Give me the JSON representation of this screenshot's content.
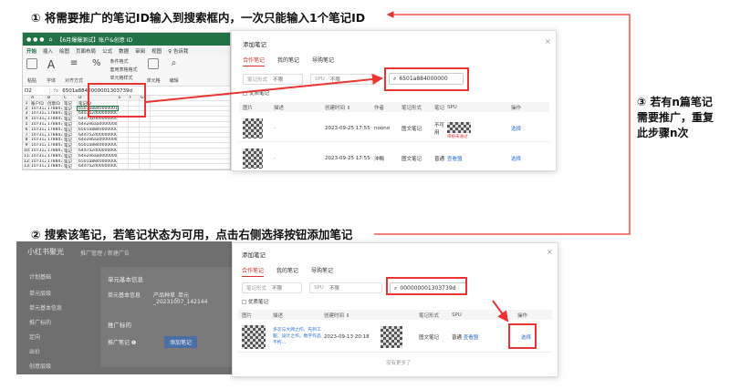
{
  "steps": {
    "step1": "① 将需要推广的笔记ID输入到搜索框内，一次只能输入1个笔记ID",
    "step2": "② 搜索该笔记，若笔记状态为可用，点击右侧选择按钮添加笔记",
    "step3_lines": [
      "③ 若有n篇笔记",
      "需要推广，重复",
      "此步骤n次"
    ]
  },
  "excel": {
    "title": "【6月爆爆测试】账户&创意 ID",
    "menu": [
      "开始",
      "插入",
      "绘图",
      "页面布局",
      "公式",
      "数据",
      "审阅",
      "视图",
      "♀ 告诉我"
    ],
    "ribbon": [
      "粘贴",
      "字体",
      "对齐方式",
      "%",
      "条件格式",
      "套用表格格式",
      "单元格样式",
      "单元格",
      "编辑"
    ],
    "name_box": "D2",
    "formula": "6501a8840000001303739d",
    "headers": [
      "",
      "A",
      "B",
      "C",
      "D",
      "E",
      "F",
      "G"
    ],
    "row_labels": [
      "1",
      "2",
      "3",
      "4",
      "5",
      "6",
      "7",
      "8",
      "9",
      "10",
      "11",
      "12",
      "13"
    ],
    "col_a": [
      "账户ID",
      "107312",
      "107312",
      "107312",
      "107312",
      "107312",
      "107312",
      "107312",
      "107312",
      "107312",
      "107312",
      "107312",
      "107312"
    ],
    "col_b": [
      "创意ID",
      "17884700",
      "17884701",
      "17884702",
      "17884703",
      "17884704",
      "17884705",
      "17884706",
      "17884707",
      "17884708",
      "17884709",
      "17884710",
      "17884711"
    ],
    "col_c": [
      "笔记",
      "笔记",
      "笔记",
      "笔记",
      "笔记",
      "笔记",
      "笔记",
      "笔记",
      "笔记",
      "笔记",
      "笔记",
      "笔记",
      "笔记"
    ],
    "col_d": [
      "笔记ID",
      "6501a8840000001303739d",
      "64d752d0000000001303a",
      "64d752d00000000010031d54",
      "64e2ebaa00000000013045",
      "6501a8840000000013d04",
      "64d752d000000000031d54",
      "64e2ebaa0000000000135",
      "6501a884000000001303",
      "64d752d00000000100031d54",
      "64e2ebaa000000000130a1",
      "6501a88400000000130374",
      "64d752d000000000001303a"
    ]
  },
  "dialog1": {
    "title": "添加笔记",
    "tabs": [
      "合作笔记",
      "我的笔记",
      "导购笔记"
    ],
    "filter1_label": "笔记形式",
    "filter1_value": "不限",
    "filter2_label": "SPU",
    "filter2_value": "不限",
    "search_value": "6501a884000000",
    "checkbox": "优质笔记",
    "columns": [
      "图片",
      "描述",
      "创建时间 ⇕",
      "作者",
      "笔记形式",
      "笔记",
      "SPU",
      "操作"
    ],
    "rows": [
      {
        "date": "2023-09-25 17:55",
        "author": "noono",
        "type": "图文笔记",
        "status": "不可用",
        "spu": "",
        "note": "审核未通过",
        "action": "选择"
      },
      {
        "date": "2023-09-25 17:55",
        "author": "沖鴨",
        "type": "图文笔记",
        "status": "普通",
        "spu": "查看盟",
        "note": "",
        "action": "选择"
      }
    ]
  },
  "app2": {
    "logo": "小红书聚光",
    "breadcrumb": "推广管理 / 新建广告",
    "nav": [
      "计划基础",
      "单元层级",
      "单元基本信息",
      "推广标的",
      "定向",
      "出价",
      "创意层级"
    ],
    "panel_title": "单元基本信息",
    "unit_name_label": "单元基本信息",
    "unit_name_value": "产品种草_单元_20231007_142144",
    "target_title": "推广标的",
    "target_label": "推广笔记 ❶",
    "add_btn": "添加笔记"
  },
  "dialog2": {
    "title": "添加笔记",
    "tabs": [
      "合作笔记",
      "我的笔记",
      "导购笔记"
    ],
    "filter1_label": "笔记形式",
    "filter1_value": "不限",
    "filter2_label": "SPU",
    "filter2_value": "不限",
    "search_value": "000000001303739d",
    "checkbox": "优质笔记",
    "columns": [
      "图片",
      "描述",
      "创建时间 ⇕",
      "作者",
      "笔记形式",
      "SPU",
      "操作"
    ],
    "row": {
      "desc": "多次与大牌之作，先到工服，设计之作，数字作品不朽…",
      "date": "2023-09-13 20:18",
      "type": "图文笔记",
      "spu": "查看盟",
      "status": "普通",
      "action": "选择"
    },
    "footer": "没有更多了"
  },
  "colors": {
    "accent_red": "#e33",
    "excel_green": "#217346",
    "link": "#2b6fd6"
  }
}
